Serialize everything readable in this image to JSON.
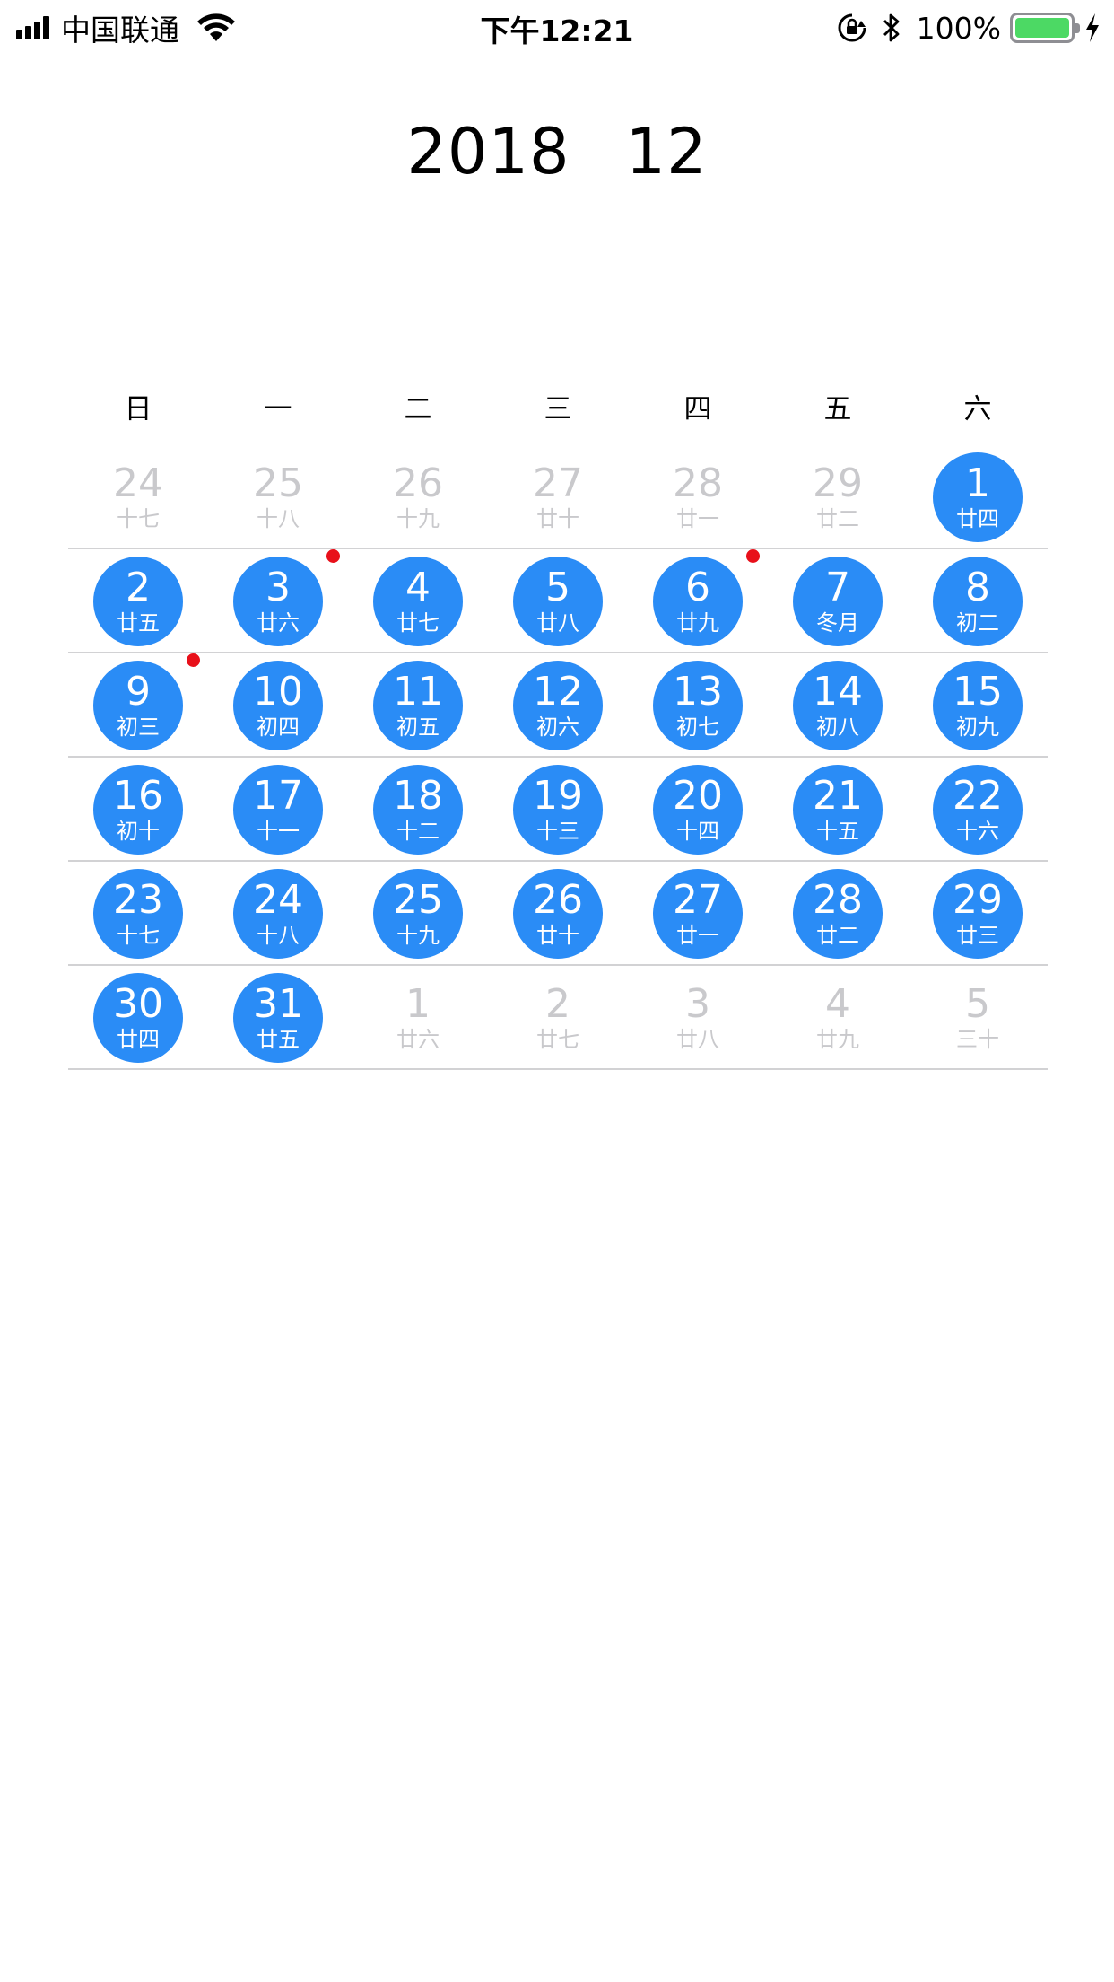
{
  "status_bar": {
    "carrier": "中国联通",
    "time": "下午12:21",
    "battery_percent": "100%",
    "battery_level": 1.0,
    "battery_color": "#4cd964",
    "icons": [
      "signal-icon",
      "wifi-icon",
      "rotation-lock-icon",
      "bluetooth-icon",
      "battery-icon",
      "charging-icon"
    ]
  },
  "header": {
    "year": "2018",
    "month": "12"
  },
  "weekdays": [
    "日",
    "一",
    "二",
    "三",
    "四",
    "五",
    "六"
  ],
  "colors": {
    "accent": "#2a8cf6",
    "event_dot": "#e8101a",
    "muted_text": "#c9c9cc"
  },
  "weeks": [
    [
      {
        "day": "24",
        "lunar": "十七",
        "current": false
      },
      {
        "day": "25",
        "lunar": "十八",
        "current": false
      },
      {
        "day": "26",
        "lunar": "十九",
        "current": false
      },
      {
        "day": "27",
        "lunar": "廿十",
        "current": false
      },
      {
        "day": "28",
        "lunar": "廿一",
        "current": false
      },
      {
        "day": "29",
        "lunar": "廿二",
        "current": false
      },
      {
        "day": "1",
        "lunar": "廿四",
        "current": true
      }
    ],
    [
      {
        "day": "2",
        "lunar": "廿五",
        "current": true
      },
      {
        "day": "3",
        "lunar": "廿六",
        "current": true,
        "event": true
      },
      {
        "day": "4",
        "lunar": "廿七",
        "current": true
      },
      {
        "day": "5",
        "lunar": "廿八",
        "current": true
      },
      {
        "day": "6",
        "lunar": "廿九",
        "current": true,
        "event": true
      },
      {
        "day": "7",
        "lunar": "冬月",
        "current": true
      },
      {
        "day": "8",
        "lunar": "初二",
        "current": true
      }
    ],
    [
      {
        "day": "9",
        "lunar": "初三",
        "current": true,
        "event": true
      },
      {
        "day": "10",
        "lunar": "初四",
        "current": true
      },
      {
        "day": "11",
        "lunar": "初五",
        "current": true
      },
      {
        "day": "12",
        "lunar": "初六",
        "current": true
      },
      {
        "day": "13",
        "lunar": "初七",
        "current": true
      },
      {
        "day": "14",
        "lunar": "初八",
        "current": true
      },
      {
        "day": "15",
        "lunar": "初九",
        "current": true
      }
    ],
    [
      {
        "day": "16",
        "lunar": "初十",
        "current": true
      },
      {
        "day": "17",
        "lunar": "十一",
        "current": true
      },
      {
        "day": "18",
        "lunar": "十二",
        "current": true
      },
      {
        "day": "19",
        "lunar": "十三",
        "current": true
      },
      {
        "day": "20",
        "lunar": "十四",
        "current": true
      },
      {
        "day": "21",
        "lunar": "十五",
        "current": true
      },
      {
        "day": "22",
        "lunar": "十六",
        "current": true
      }
    ],
    [
      {
        "day": "23",
        "lunar": "十七",
        "current": true
      },
      {
        "day": "24",
        "lunar": "十八",
        "current": true
      },
      {
        "day": "25",
        "lunar": "十九",
        "current": true
      },
      {
        "day": "26",
        "lunar": "廿十",
        "current": true
      },
      {
        "day": "27",
        "lunar": "廿一",
        "current": true
      },
      {
        "day": "28",
        "lunar": "廿二",
        "current": true
      },
      {
        "day": "29",
        "lunar": "廿三",
        "current": true
      }
    ],
    [
      {
        "day": "30",
        "lunar": "廿四",
        "current": true
      },
      {
        "day": "31",
        "lunar": "廿五",
        "current": true
      },
      {
        "day": "1",
        "lunar": "廿六",
        "current": false
      },
      {
        "day": "2",
        "lunar": "廿七",
        "current": false
      },
      {
        "day": "3",
        "lunar": "廿八",
        "current": false
      },
      {
        "day": "4",
        "lunar": "廿九",
        "current": false
      },
      {
        "day": "5",
        "lunar": "三十",
        "current": false
      }
    ]
  ]
}
